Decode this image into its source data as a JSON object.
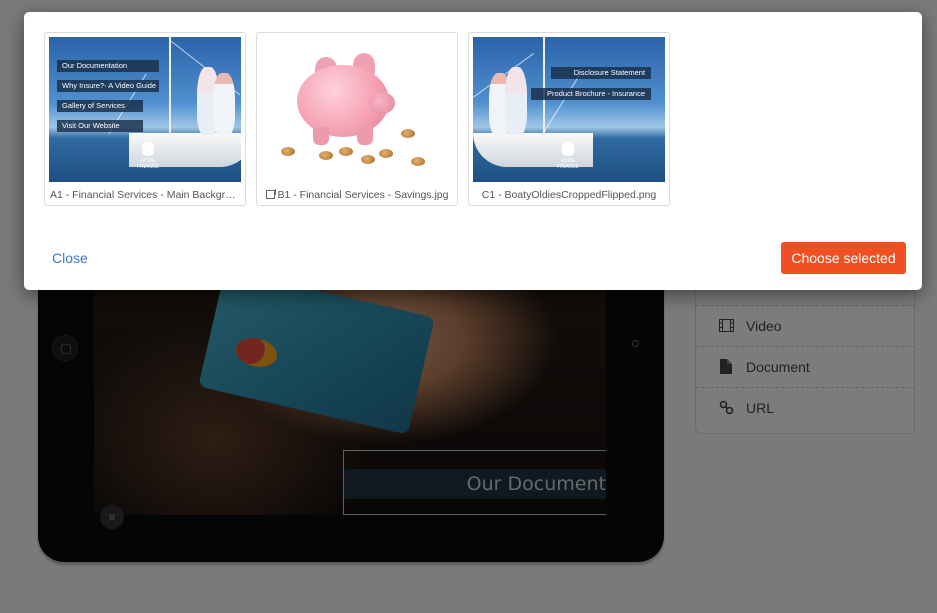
{
  "modal": {
    "assets": [
      {
        "caption": "A1 - Financial Services - Main Backgro···",
        "overlay_items": [
          "Our Documentation",
          "Why Insure?- A Video Guide",
          "Gallery of Services",
          "Visit Our Website"
        ],
        "logo_text": [
          "ACME",
          "FINANCE"
        ]
      },
      {
        "caption": "B1 - Financial Services - Savings.jpg",
        "icon": "copy-icon"
      },
      {
        "caption": "C1 - BoatyOldiesCroppedFlipped.png",
        "overlay_items": [
          "Disclosure Statement",
          "Product Brochure - Insurance"
        ],
        "logo_text": [
          "ACME",
          "FINANCE"
        ]
      }
    ],
    "close_label": "Close",
    "choose_label": "Choose selected"
  },
  "preview": {
    "overlay_title": "Our Documentation"
  },
  "side_menu": {
    "items": [
      {
        "label": "Video",
        "icon": "film-icon"
      },
      {
        "label": "Document",
        "icon": "document-icon"
      },
      {
        "label": "URL",
        "icon": "link-icon"
      }
    ]
  },
  "colors": {
    "accent_button": "#f04e23",
    "link": "#3a78c3"
  }
}
